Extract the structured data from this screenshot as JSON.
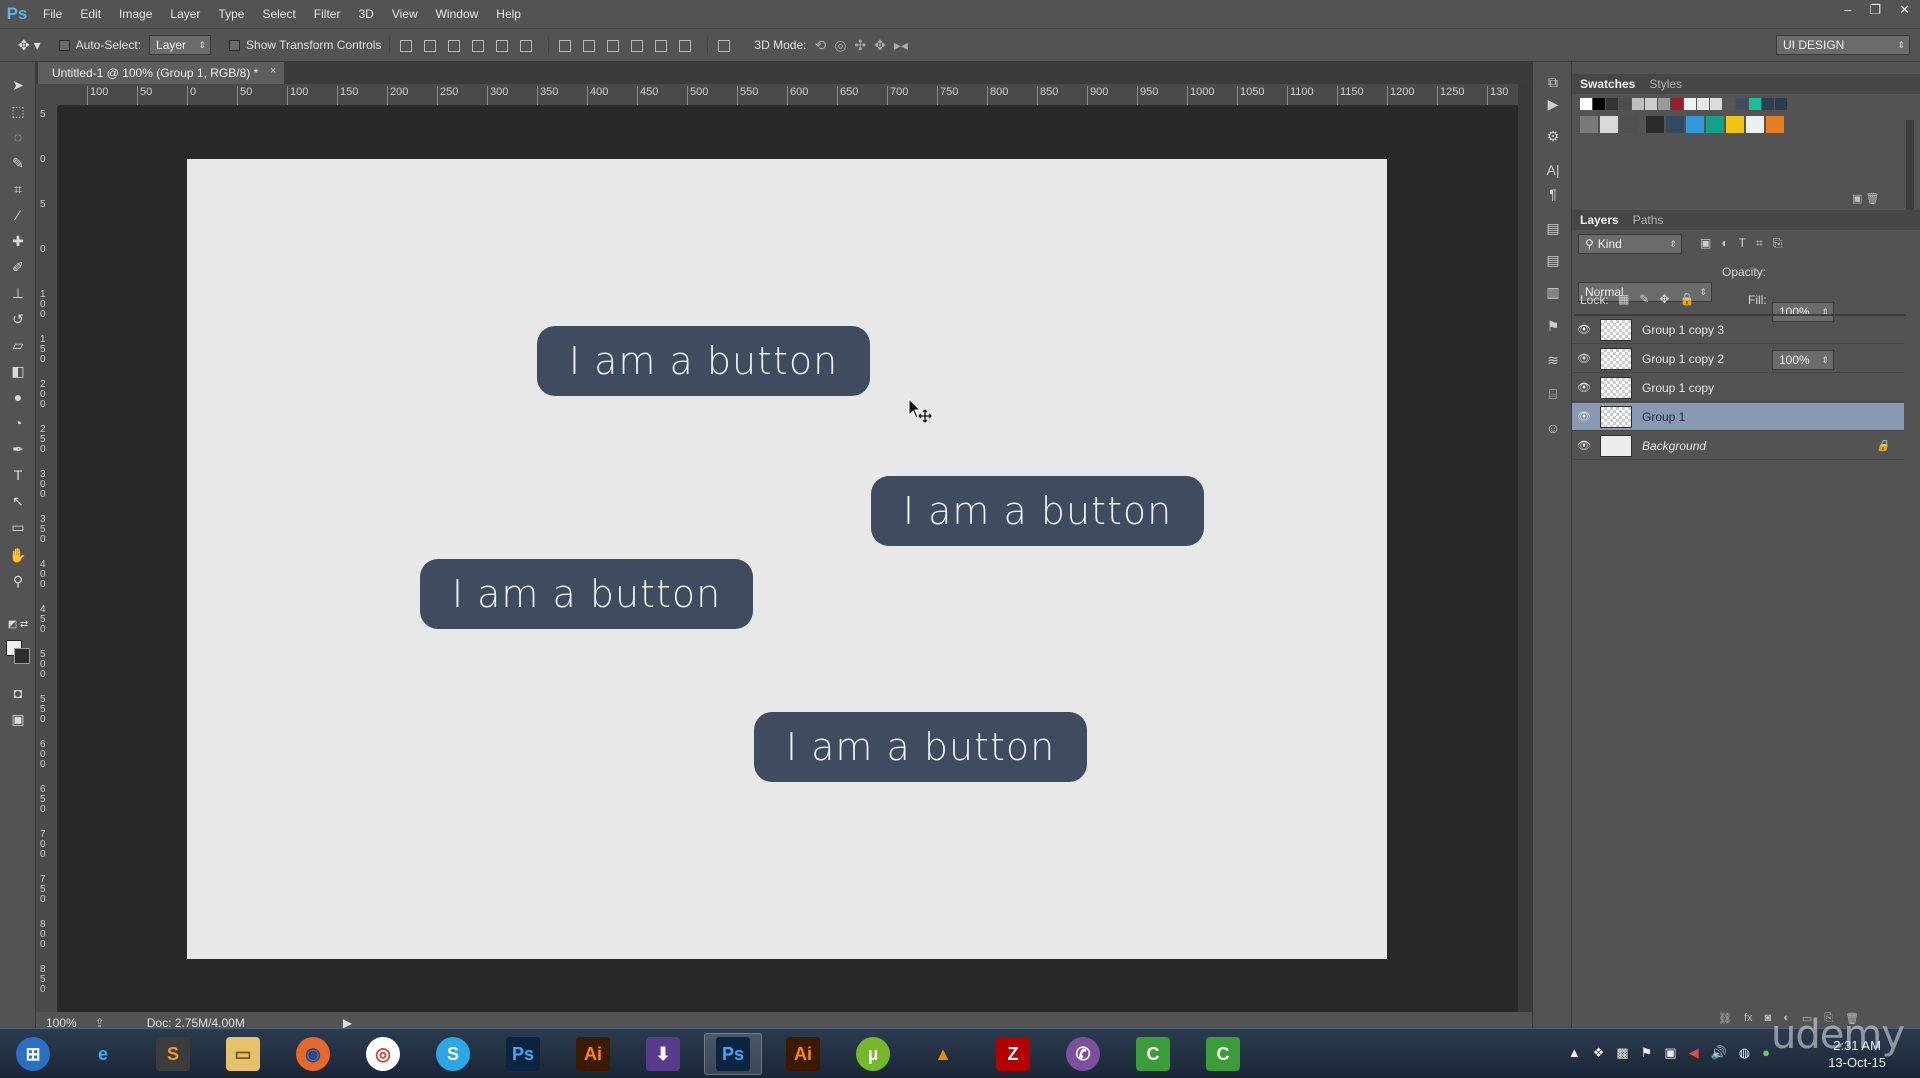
{
  "app": {
    "logo": "Ps"
  },
  "menu": [
    "File",
    "Edit",
    "Image",
    "Layer",
    "Type",
    "Select",
    "Filter",
    "3D",
    "View",
    "Window",
    "Help"
  ],
  "window_controls": {
    "minimize": "–",
    "restore": "❐",
    "close": "✕"
  },
  "options": {
    "auto_select_label": "Auto-Select:",
    "auto_select_value": "Layer",
    "transform_label": "Show Transform Controls",
    "mode_3d_label": "3D Mode:",
    "workspace": "UI DESIGN"
  },
  "document": {
    "tab_title": "Untitled-1 @ 100% (Group 1, RGB/8) *",
    "close": "×"
  },
  "ruler_h": [
    "100",
    "50",
    "0",
    "50",
    "100",
    "150",
    "200",
    "250",
    "300",
    "350",
    "400",
    "450",
    "500",
    "550",
    "600",
    "650",
    "700",
    "750",
    "800",
    "850",
    "900",
    "950",
    "1000",
    "1050",
    "1100",
    "1150",
    "1200",
    "1250",
    "130"
  ],
  "ruler_v": [
    "5",
    "0",
    "5",
    "0",
    "1 0 0",
    "1 5 0",
    "2 0 0",
    "2 5 0",
    "3 0 0",
    "3 5 0",
    "4 0 0",
    "4 5 0",
    "5 0 0",
    "5 5 0",
    "6 0 0",
    "6 5 0",
    "7 0 0",
    "7 5 0",
    "8 0 0",
    "8 5 0"
  ],
  "canvas": {
    "buttons": [
      {
        "label": "I am a button"
      },
      {
        "label": "I am a button"
      },
      {
        "label": "I am a button"
      },
      {
        "label": "I am a button"
      }
    ],
    "button_color": "#3f4b5e",
    "artboard_color": "#e8e8e8"
  },
  "status": {
    "zoom": "100%",
    "doc": "Doc: 2.75M/4.00M"
  },
  "swatches_panel": {
    "tabs": [
      "Swatches",
      "Styles"
    ],
    "row1": [
      "#ffffff",
      "#000000",
      "#333333",
      "#4d4d4d",
      "#bfbfbf",
      "#cccccc",
      "#999999",
      "#9b1d2b",
      "#f2f2f2",
      "#e6e6e6",
      "#dcdcdc",
      "#585858",
      "#3f4b5e",
      "#1bbc9b",
      "#2c3e50",
      "#2e3b4e"
    ],
    "row2": [
      "#7a7a7a",
      "#d9d9d9",
      "#505050",
      "#2b2b2b",
      "#34495e",
      "#3498db",
      "#16a085",
      "#f1c40f",
      "#ecf0f1",
      "#e67e22"
    ]
  },
  "layers_panel": {
    "tabs": [
      "Layers",
      "Paths"
    ],
    "kind": "Kind",
    "blend": "Normal",
    "opacity_label": "Opacity:",
    "opacity": "100%",
    "lock_label": "Lock:",
    "fill_label": "Fill:",
    "fill": "100%",
    "layers": [
      {
        "name": "Group 1 copy 3",
        "selected": false
      },
      {
        "name": "Group 1 copy 2",
        "selected": false
      },
      {
        "name": "Group 1 copy",
        "selected": false
      },
      {
        "name": "Group 1",
        "selected": true
      },
      {
        "name": "Background",
        "selected": false
      }
    ]
  },
  "taskbar": {
    "apps": [
      "start-orb",
      "internet-explorer",
      "sublime-text",
      "file-explorer",
      "firefox",
      "chrome",
      "skype",
      "photoshop",
      "illustrator",
      "downloader",
      "photoshop",
      "illustrator",
      "utorrent",
      "vlc",
      "filezilla",
      "viber",
      "camtasia",
      "camtasia"
    ],
    "time": "2:31 AM",
    "date": "13-Oct-15"
  },
  "watermark": "udemy"
}
